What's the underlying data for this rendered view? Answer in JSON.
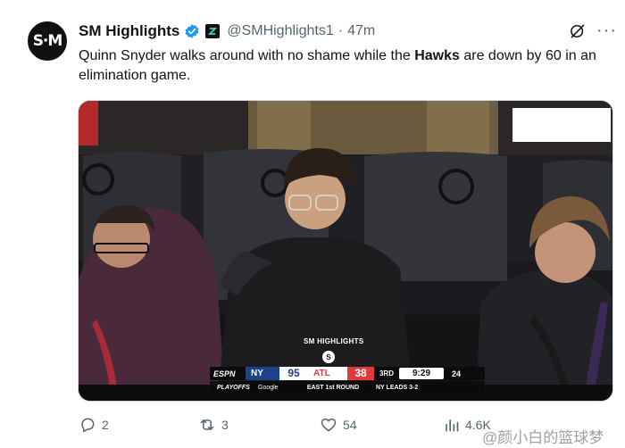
{
  "tweet": {
    "author_initials": "S·M",
    "author_name": "SM Highlights",
    "handle": "@SMHighlights1",
    "separator": "·",
    "time": "47m",
    "text_before": "Quinn Snyder walks around with no shame while the ",
    "text_bold": "Hawks",
    "text_after": " are down by 60 in an elimination game."
  },
  "media": {
    "watermark": "SM HIGHLIGHTS",
    "logo_letter": "S",
    "scorebug": {
      "network": "ESPN",
      "team1": "NY",
      "score1": "95",
      "team2": "ATL",
      "score2": "38",
      "period": "3RD",
      "clock": "9:29",
      "shot_clock": "24",
      "event": "PLAYOFFS",
      "sponsor": "Google",
      "round": "EAST 1st ROUND",
      "series": "NY LEADS 3-2"
    }
  },
  "actions": {
    "replies": "2",
    "reposts": "3",
    "likes": "54",
    "views": "4.6K"
  },
  "overlay": {
    "watermark_text": "@颜小白的篮球梦"
  },
  "colors": {
    "accent": "#1d9bf0",
    "muted": "#536471",
    "knicks_blue": "#1d428a",
    "hawks_red": "#e03a3e"
  }
}
